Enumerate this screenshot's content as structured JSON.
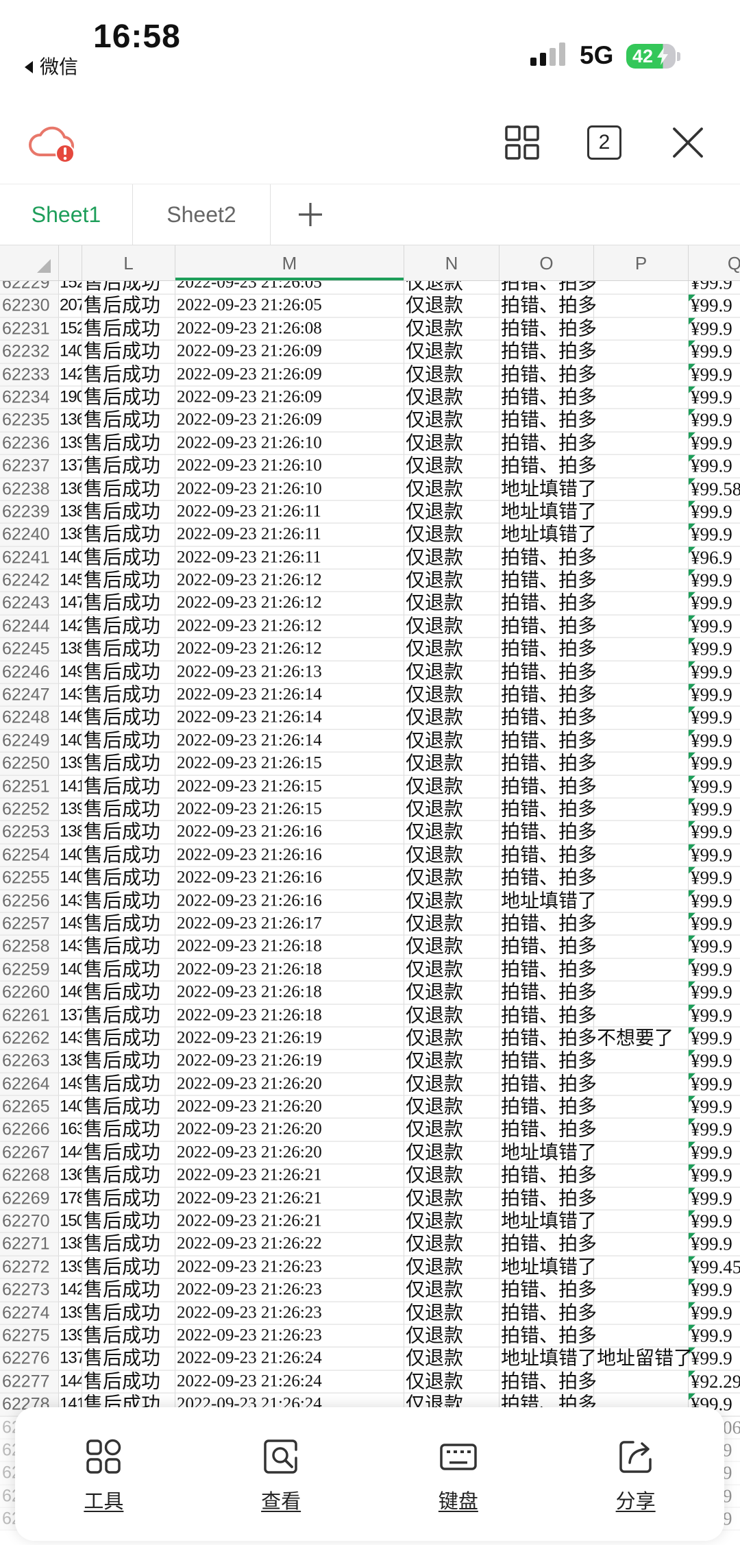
{
  "status_bar": {
    "time": "16:58",
    "back_label": "微信",
    "network": "5G",
    "battery_level": "42"
  },
  "toolbar": {
    "sheet_count": "2",
    "icons": [
      "cloud-sync-error-icon",
      "grid-view-icon",
      "close-icon"
    ]
  },
  "tabs": [
    {
      "label": "Sheet1",
      "active": true
    },
    {
      "label": "Sheet2",
      "active": false
    }
  ],
  "colors": {
    "accent": "#1e9e5a",
    "alert": "#e5483d",
    "cloud": "#e8776a",
    "battery": "#34c759"
  },
  "sheet": {
    "columns": [
      "L",
      "M",
      "N",
      "O",
      "P",
      "Q"
    ],
    "selected_column": "M",
    "rows": [
      {
        "num": "62229",
        "k": "152",
        "l": "售后成功",
        "m": "2022-09-23 21:26:05",
        "n": "仅退款",
        "o": "拍错、拍多",
        "q": "¥99.9"
      },
      {
        "num": "62230",
        "k": "207",
        "l": "售后成功",
        "m": "2022-09-23 21:26:05",
        "n": "仅退款",
        "o": "拍错、拍多",
        "q": "¥99.9"
      },
      {
        "num": "62231",
        "k": "152",
        "l": "售后成功",
        "m": "2022-09-23 21:26:08",
        "n": "仅退款",
        "o": "拍错、拍多",
        "q": "¥99.9"
      },
      {
        "num": "62232",
        "k": "140",
        "l": "售后成功",
        "m": "2022-09-23 21:26:09",
        "n": "仅退款",
        "o": "拍错、拍多",
        "q": "¥99.9"
      },
      {
        "num": "62233",
        "k": "142",
        "l": "售后成功",
        "m": "2022-09-23 21:26:09",
        "n": "仅退款",
        "o": "拍错、拍多",
        "q": "¥99.9"
      },
      {
        "num": "62234",
        "k": "190",
        "l": "售后成功",
        "m": "2022-09-23 21:26:09",
        "n": "仅退款",
        "o": "拍错、拍多",
        "q": "¥99.9"
      },
      {
        "num": "62235",
        "k": "136",
        "l": "售后成功",
        "m": "2022-09-23 21:26:09",
        "n": "仅退款",
        "o": "拍错、拍多",
        "q": "¥99.9"
      },
      {
        "num": "62236",
        "k": "139",
        "l": "售后成功",
        "m": "2022-09-23 21:26:10",
        "n": "仅退款",
        "o": "拍错、拍多",
        "q": "¥99.9"
      },
      {
        "num": "62237",
        "k": "137",
        "l": "售后成功",
        "m": "2022-09-23 21:26:10",
        "n": "仅退款",
        "o": "拍错、拍多",
        "q": "¥99.9"
      },
      {
        "num": "62238",
        "k": "136",
        "l": "售后成功",
        "m": "2022-09-23 21:26:10",
        "n": "仅退款",
        "o": "地址填错了",
        "q": "¥99.58"
      },
      {
        "num": "62239",
        "k": "138",
        "l": "售后成功",
        "m": "2022-09-23 21:26:11",
        "n": "仅退款",
        "o": "地址填错了",
        "q": "¥99.9"
      },
      {
        "num": "62240",
        "k": "138",
        "l": "售后成功",
        "m": "2022-09-23 21:26:11",
        "n": "仅退款",
        "o": "地址填错了",
        "q": "¥99.9"
      },
      {
        "num": "62241",
        "k": "140",
        "l": "售后成功",
        "m": "2022-09-23 21:26:11",
        "n": "仅退款",
        "o": "拍错、拍多",
        "q": "¥96.9"
      },
      {
        "num": "62242",
        "k": "145",
        "l": "售后成功",
        "m": "2022-09-23 21:26:12",
        "n": "仅退款",
        "o": "拍错、拍多",
        "q": "¥99.9"
      },
      {
        "num": "62243",
        "k": "147",
        "l": "售后成功",
        "m": "2022-09-23 21:26:12",
        "n": "仅退款",
        "o": "拍错、拍多",
        "q": "¥99.9"
      },
      {
        "num": "62244",
        "k": "142",
        "l": "售后成功",
        "m": "2022-09-23 21:26:12",
        "n": "仅退款",
        "o": "拍错、拍多",
        "q": "¥99.9"
      },
      {
        "num": "62245",
        "k": "138",
        "l": "售后成功",
        "m": "2022-09-23 21:26:12",
        "n": "仅退款",
        "o": "拍错、拍多",
        "q": "¥99.9"
      },
      {
        "num": "62246",
        "k": "149",
        "l": "售后成功",
        "m": "2022-09-23 21:26:13",
        "n": "仅退款",
        "o": "拍错、拍多",
        "q": "¥99.9"
      },
      {
        "num": "62247",
        "k": "143",
        "l": "售后成功",
        "m": "2022-09-23 21:26:14",
        "n": "仅退款",
        "o": "拍错、拍多",
        "q": "¥99.9"
      },
      {
        "num": "62248",
        "k": "146",
        "l": "售后成功",
        "m": "2022-09-23 21:26:14",
        "n": "仅退款",
        "o": "拍错、拍多",
        "q": "¥99.9"
      },
      {
        "num": "62249",
        "k": "140",
        "l": "售后成功",
        "m": "2022-09-23 21:26:14",
        "n": "仅退款",
        "o": "拍错、拍多",
        "q": "¥99.9"
      },
      {
        "num": "62250",
        "k": "139",
        "l": "售后成功",
        "m": "2022-09-23 21:26:15",
        "n": "仅退款",
        "o": "拍错、拍多",
        "q": "¥99.9"
      },
      {
        "num": "62251",
        "k": "141",
        "l": "售后成功",
        "m": "2022-09-23 21:26:15",
        "n": "仅退款",
        "o": "拍错、拍多",
        "q": "¥99.9"
      },
      {
        "num": "62252",
        "k": "139",
        "l": "售后成功",
        "m": "2022-09-23 21:26:15",
        "n": "仅退款",
        "o": "拍错、拍多",
        "q": "¥99.9"
      },
      {
        "num": "62253",
        "k": "138",
        "l": "售后成功",
        "m": "2022-09-23 21:26:16",
        "n": "仅退款",
        "o": "拍错、拍多",
        "q": "¥99.9"
      },
      {
        "num": "62254",
        "k": "140",
        "l": "售后成功",
        "m": "2022-09-23 21:26:16",
        "n": "仅退款",
        "o": "拍错、拍多",
        "q": "¥99.9"
      },
      {
        "num": "62255",
        "k": "140",
        "l": "售后成功",
        "m": "2022-09-23 21:26:16",
        "n": "仅退款",
        "o": "拍错、拍多",
        "q": "¥99.9"
      },
      {
        "num": "62256",
        "k": "143",
        "l": "售后成功",
        "m": "2022-09-23 21:26:16",
        "n": "仅退款",
        "o": "地址填错了",
        "q": "¥99.9"
      },
      {
        "num": "62257",
        "k": "149",
        "l": "售后成功",
        "m": "2022-09-23 21:26:17",
        "n": "仅退款",
        "o": "拍错、拍多",
        "q": "¥99.9"
      },
      {
        "num": "62258",
        "k": "143",
        "l": "售后成功",
        "m": "2022-09-23 21:26:18",
        "n": "仅退款",
        "o": "拍错、拍多",
        "q": "¥99.9"
      },
      {
        "num": "62259",
        "k": "140",
        "l": "售后成功",
        "m": "2022-09-23 21:26:18",
        "n": "仅退款",
        "o": "拍错、拍多",
        "q": "¥99.9"
      },
      {
        "num": "62260",
        "k": "146",
        "l": "售后成功",
        "m": "2022-09-23 21:26:18",
        "n": "仅退款",
        "o": "拍错、拍多",
        "q": "¥99.9"
      },
      {
        "num": "62261",
        "k": "137",
        "l": "售后成功",
        "m": "2022-09-23 21:26:18",
        "n": "仅退款",
        "o": "拍错、拍多",
        "q": "¥99.9"
      },
      {
        "num": "62262",
        "k": "143",
        "l": "售后成功",
        "m": "2022-09-23 21:26:19",
        "n": "仅退款",
        "o": "拍错、拍多不想要了",
        "q": "¥99.9"
      },
      {
        "num": "62263",
        "k": "138",
        "l": "售后成功",
        "m": "2022-09-23 21:26:19",
        "n": "仅退款",
        "o": "拍错、拍多",
        "q": "¥99.9"
      },
      {
        "num": "62264",
        "k": "149",
        "l": "售后成功",
        "m": "2022-09-23 21:26:20",
        "n": "仅退款",
        "o": "拍错、拍多",
        "q": "¥99.9"
      },
      {
        "num": "62265",
        "k": "140",
        "l": "售后成功",
        "m": "2022-09-23 21:26:20",
        "n": "仅退款",
        "o": "拍错、拍多",
        "q": "¥99.9"
      },
      {
        "num": "62266",
        "k": "163",
        "l": "售后成功",
        "m": "2022-09-23 21:26:20",
        "n": "仅退款",
        "o": "拍错、拍多",
        "q": "¥99.9"
      },
      {
        "num": "62267",
        "k": "144",
        "l": "售后成功",
        "m": "2022-09-23 21:26:20",
        "n": "仅退款",
        "o": "地址填错了",
        "q": "¥99.9"
      },
      {
        "num": "62268",
        "k": "136",
        "l": "售后成功",
        "m": "2022-09-23 21:26:21",
        "n": "仅退款",
        "o": "拍错、拍多",
        "q": "¥99.9"
      },
      {
        "num": "62269",
        "k": "178",
        "l": "售后成功",
        "m": "2022-09-23 21:26:21",
        "n": "仅退款",
        "o": "拍错、拍多",
        "q": "¥99.9"
      },
      {
        "num": "62270",
        "k": "150",
        "l": "售后成功",
        "m": "2022-09-23 21:26:21",
        "n": "仅退款",
        "o": "地址填错了",
        "q": "¥99.9"
      },
      {
        "num": "62271",
        "k": "138",
        "l": "售后成功",
        "m": "2022-09-23 21:26:22",
        "n": "仅退款",
        "o": "拍错、拍多",
        "q": "¥99.9"
      },
      {
        "num": "62272",
        "k": "139",
        "l": "售后成功",
        "m": "2022-09-23 21:26:23",
        "n": "仅退款",
        "o": "地址填错了",
        "q": "¥99.45"
      },
      {
        "num": "62273",
        "k": "142",
        "l": "售后成功",
        "m": "2022-09-23 21:26:23",
        "n": "仅退款",
        "o": "拍错、拍多",
        "q": "¥99.9"
      },
      {
        "num": "62274",
        "k": "139",
        "l": "售后成功",
        "m": "2022-09-23 21:26:23",
        "n": "仅退款",
        "o": "拍错、拍多",
        "q": "¥99.9"
      },
      {
        "num": "62275",
        "k": "139",
        "l": "售后成功",
        "m": "2022-09-23 21:26:23",
        "n": "仅退款",
        "o": "拍错、拍多",
        "q": "¥99.9"
      },
      {
        "num": "62276",
        "k": "137",
        "l": "售后成功",
        "m": "2022-09-23 21:26:24",
        "n": "仅退款",
        "o": "地址填错了地址留错了",
        "q": "¥99.9"
      },
      {
        "num": "62277",
        "k": "144",
        "l": "售后成功",
        "m": "2022-09-23 21:26:24",
        "n": "仅退款",
        "o": "拍错、拍多",
        "q": "¥92.29"
      },
      {
        "num": "62278",
        "k": "141",
        "l": "售后成功",
        "m": "2022-09-23 21:26:24",
        "n": "仅退款",
        "o": "拍错、拍多",
        "q": "¥99.9"
      }
    ],
    "rows_under_panel": [
      {
        "num": "62",
        "q": "06"
      },
      {
        "num": "62",
        "q": "9"
      },
      {
        "num": "62",
        "q": "9"
      },
      {
        "num": "62",
        "q": "9"
      },
      {
        "num": "62",
        "q": "9"
      }
    ]
  },
  "bottom_bar": {
    "items": [
      {
        "label": "工具",
        "icon": "tools-icon"
      },
      {
        "label": "查看",
        "icon": "view-search-icon"
      },
      {
        "label": "键盘",
        "icon": "keyboard-icon"
      },
      {
        "label": "分享",
        "icon": "share-icon"
      }
    ]
  }
}
